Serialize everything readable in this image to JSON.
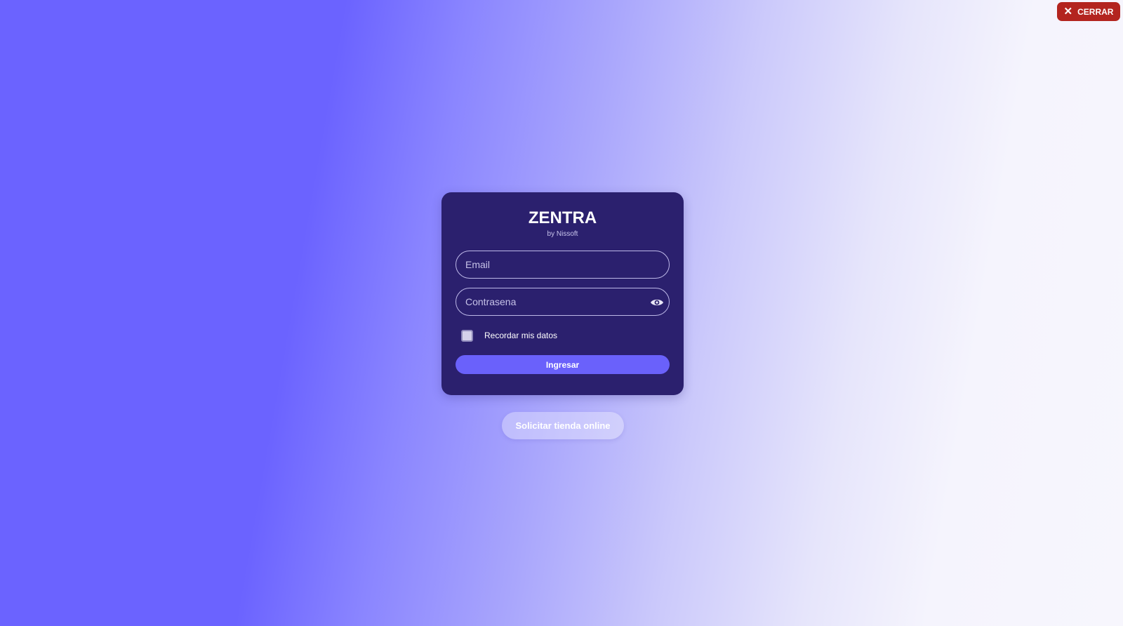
{
  "header": {
    "close_label": "CERRAR",
    "close_icon": "close-icon"
  },
  "login": {
    "title": "ZENTRA",
    "subtitle": "by Nissoft",
    "email_placeholder": "Email",
    "email_value": "",
    "password_placeholder": "Contrasena",
    "password_value": "",
    "password_icon": "eye-icon",
    "remember_label": "Recordar mis datos",
    "remember_checked": false,
    "submit_label": "Ingresar"
  },
  "footer": {
    "request_label": "Solicitar tienda online"
  },
  "colors": {
    "card_bg": "#2b206e",
    "accent": "#6a61fb",
    "close_bg": "#b3241f"
  }
}
